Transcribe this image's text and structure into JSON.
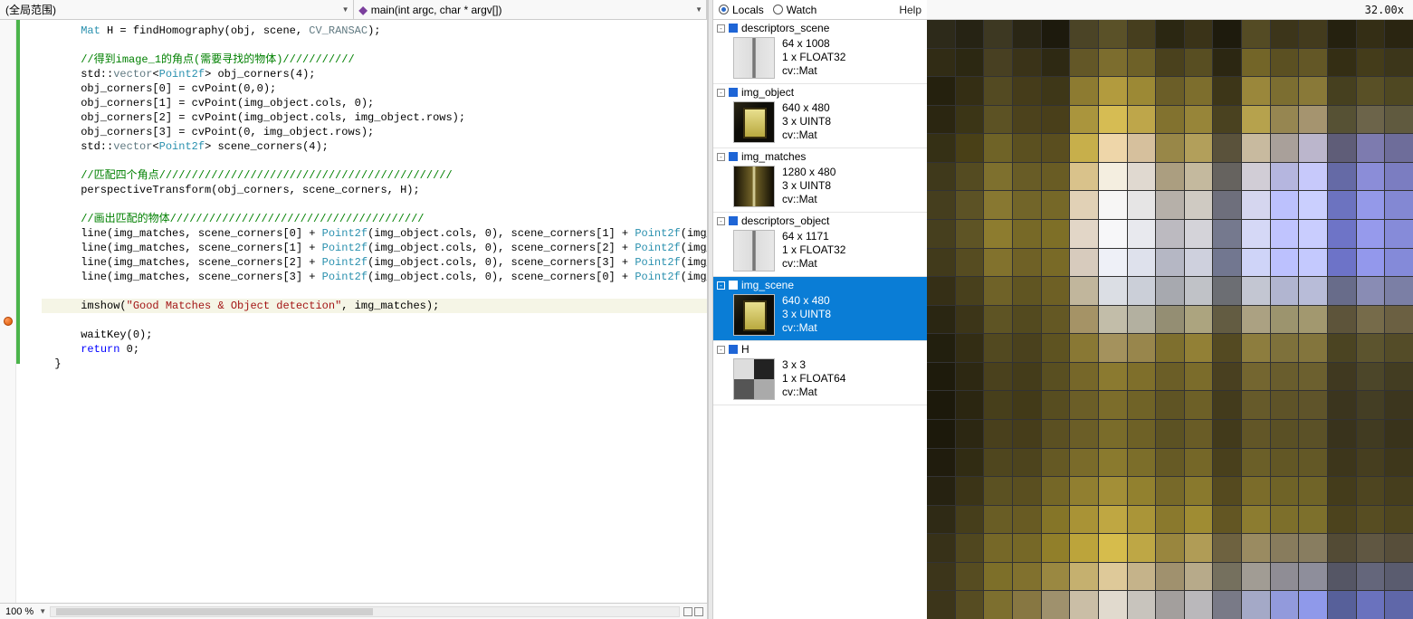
{
  "selectors": {
    "scope": "(全局范围)",
    "function": "main(int argc, char * argv[])"
  },
  "code_tokens": [
    [
      [
        "      "
      ],
      [
        "Mat",
        "type"
      ],
      [
        " H = findHomography(obj, scene, "
      ],
      [
        "CV_RANSAC",
        "teal"
      ],
      [
        ");"
      ]
    ],
    [
      [
        ""
      ]
    ],
    [
      [
        "      "
      ],
      [
        "//得到image_1的角点(需要寻找的物体)///////////",
        "comment"
      ]
    ],
    [
      [
        "      std::"
      ],
      [
        "vector",
        "teal"
      ],
      [
        "<"
      ],
      [
        "Point2f",
        "type"
      ],
      [
        "> obj_corners(4);"
      ]
    ],
    [
      [
        "      obj_corners[0] = cvPoint(0,0);"
      ]
    ],
    [
      [
        "      obj_corners[1] = cvPoint(img_object.cols, 0);"
      ]
    ],
    [
      [
        "      obj_corners[2] = cvPoint(img_object.cols, img_object.rows);"
      ]
    ],
    [
      [
        "      obj_corners[3] = cvPoint(0, img_object.rows);"
      ]
    ],
    [
      [
        "      std::"
      ],
      [
        "vector",
        "teal"
      ],
      [
        "<"
      ],
      [
        "Point2f",
        "type"
      ],
      [
        "> scene_corners(4);"
      ]
    ],
    [
      [
        ""
      ]
    ],
    [
      [
        "      "
      ],
      [
        "//匹配四个角点/////////////////////////////////////////////",
        "comment"
      ]
    ],
    [
      [
        "      perspectiveTransform(obj_corners, scene_corners, H);"
      ]
    ],
    [
      [
        ""
      ]
    ],
    [
      [
        "      "
      ],
      [
        "//画出匹配的物体///////////////////////////////////////",
        "comment"
      ]
    ],
    [
      [
        "      line(img_matches, scene_corners[0] + "
      ],
      [
        "Point2f",
        "type"
      ],
      [
        "(img_object.cols, 0), scene_corners[1] + "
      ],
      [
        "Point2f",
        "type"
      ],
      [
        "(img_ob"
      ]
    ],
    [
      [
        "      line(img_matches, scene_corners[1] + "
      ],
      [
        "Point2f",
        "type"
      ],
      [
        "(img_object.cols, 0), scene_corners[2] + "
      ],
      [
        "Point2f",
        "type"
      ],
      [
        "(img_ob"
      ]
    ],
    [
      [
        "      line(img_matches, scene_corners[2] + "
      ],
      [
        "Point2f",
        "type"
      ],
      [
        "(img_object.cols, 0), scene_corners[3] + "
      ],
      [
        "Point2f",
        "type"
      ],
      [
        "(img_ob"
      ]
    ],
    [
      [
        "      line(img_matches, scene_corners[3] + "
      ],
      [
        "Point2f",
        "type"
      ],
      [
        "(img_object.cols, 0), scene_corners[0] + "
      ],
      [
        "Point2f",
        "type"
      ],
      [
        "(img_ob"
      ]
    ],
    [
      [
        ""
      ]
    ],
    [
      [
        "      imshow("
      ],
      [
        "\"Good Matches & Object detection\"",
        "str"
      ],
      [
        ", img_matches);"
      ]
    ],
    [
      [
        ""
      ]
    ],
    [
      [
        "      waitKey(0);"
      ]
    ],
    [
      [
        "      "
      ],
      [
        "return",
        "blue"
      ],
      [
        " 0;"
      ]
    ],
    [
      [
        "  }"
      ]
    ]
  ],
  "highlight_index": 19,
  "zoom": "100 %",
  "inspector": {
    "tab_locals": "Locals",
    "tab_watch": "Watch",
    "help": "Help",
    "vars": [
      {
        "name": "descriptors_scene",
        "dims": "64 x 1008",
        "type": "1 x FLOAT32",
        "cls": "cv::Mat",
        "thumb": "grad",
        "selected": false
      },
      {
        "name": "img_object",
        "dims": "640 x 480",
        "type": "3 x UINT8",
        "cls": "cv::Mat",
        "thumb": "obj",
        "selected": false
      },
      {
        "name": "img_matches",
        "dims": "1280 x 480",
        "type": "3 x UINT8",
        "cls": "cv::Mat",
        "thumb": "match",
        "selected": false
      },
      {
        "name": "descriptors_object",
        "dims": "64 x 1171",
        "type": "1 x FLOAT32",
        "cls": "cv::Mat",
        "thumb": "grad",
        "selected": false
      },
      {
        "name": "img_scene",
        "dims": "640 x 480",
        "type": "3 x UINT8",
        "cls": "cv::Mat",
        "thumb": "obj",
        "selected": true
      },
      {
        "name": "H",
        "dims": "3 x 3",
        "type": "1 x FLOAT64",
        "cls": "cv::Mat",
        "thumb": "chk",
        "selected": false
      }
    ]
  },
  "image_zoom": "32.00x",
  "pixel_colors": [
    "#2d2a1a",
    "#262314",
    "#3d3822",
    "#2a2615",
    "#1d1a0d",
    "#4b4426",
    "#5a5128",
    "#463e1e",
    "#2b2712",
    "#3a3318",
    "#1e1b0d",
    "#544b24",
    "#3c351a",
    "#433b1d",
    "#25210f",
    "#342e15",
    "#2a2511",
    "#312c15",
    "#2c2812",
    "#484022",
    "#3a3318",
    "#2e2913",
    "#635727",
    "#7c6d2e",
    "#6e6128",
    "#4a411d",
    "#584e22",
    "#2c2712",
    "#736528",
    "#5b5022",
    "#635726",
    "#342e14",
    "#443c1a",
    "#3c361a",
    "#25210e",
    "#342e14",
    "#534a22",
    "#453c1a",
    "#3e3718",
    "#8d7b31",
    "#b29b3e",
    "#9c8935",
    "#6b5e28",
    "#7d6e2d",
    "#3d3618",
    "#9a873b",
    "#7c6e31",
    "#897938",
    "#46401f",
    "#595026",
    "#4f4822",
    "#2b2611",
    "#3b3516",
    "#5c5224",
    "#4c421c",
    "#493f1a",
    "#aa953d",
    "#d6bc53",
    "#bea64a",
    "#82722f",
    "#978539",
    "#4a4220",
    "#b6a24d",
    "#968651",
    "#a5946f",
    "#565134",
    "#6c644a",
    "#605a3f",
    "#353015",
    "#494017",
    "#6f6327",
    "#5b5020",
    "#5a4e1f",
    "#c7af4b",
    "#eed6a9",
    "#d6c09d",
    "#988748",
    "#b29f5b",
    "#5a523b",
    "#c8ba9f",
    "#a9a09a",
    "#bbb6cc",
    "#5f5d78",
    "#7d7baf",
    "#6e6d9a",
    "#3f391b",
    "#544b21",
    "#7e702e",
    "#685c26",
    "#695c24",
    "#d9c28b",
    "#f4eee0",
    "#e0d9d0",
    "#ab9e80",
    "#c4b99e",
    "#66635f",
    "#d1cdd6",
    "#b5b6df",
    "#c7c9fb",
    "#656aa6",
    "#8b8dd8",
    "#7b7dc1",
    "#453e1e",
    "#5c5225",
    "#887831",
    "#726529",
    "#766828",
    "#e1d1b6",
    "#f7f6f5",
    "#e6e5e5",
    "#b6b0a9",
    "#cfcac2",
    "#6e6f7c",
    "#d5d6ef",
    "#bcc1fd",
    "#cacffe",
    "#6c73c0",
    "#9499e9",
    "#8388d3",
    "#463f1e",
    "#5e5425",
    "#8d7c2f",
    "#776927",
    "#7e6f27",
    "#e2d6c7",
    "#f7f7f9",
    "#e8e9ee",
    "#bcbac0",
    "#d4d3d9",
    "#75798e",
    "#d5d8f6",
    "#c0c4fe",
    "#c9cdfe",
    "#6e74c7",
    "#969aec",
    "#868bd9",
    "#413a1b",
    "#564c21",
    "#82722d",
    "#6f6126",
    "#796a27",
    "#d7cbbd",
    "#eef0f7",
    "#dee1ec",
    "#b5b7c4",
    "#ced0dd",
    "#727790",
    "#cfd4f8",
    "#bcc1fe",
    "#c4c9fe",
    "#6d73c8",
    "#9398ec",
    "#848ad9",
    "#352f16",
    "#48401c",
    "#6f6228",
    "#605522",
    "#6e6025",
    "#c1b69c",
    "#dbdee4",
    "#cbcfd8",
    "#a7a9af",
    "#c0c2c7",
    "#6c6e73",
    "#c3c6d2",
    "#b1b5d0",
    "#b8bcd8",
    "#686c8a",
    "#898cb4",
    "#7b7fa5",
    "#2a2612",
    "#3c3518",
    "#5e5424",
    "#534a1f",
    "#645824",
    "#a59366",
    "#c2bda9",
    "#b3b0a0",
    "#948e73",
    "#aca47f",
    "#635c42",
    "#aba182",
    "#9c946e",
    "#a2986f",
    "#5d543a",
    "#766b4a",
    "#6b6042",
    "#221f0e",
    "#332d14",
    "#524920",
    "#4a411d",
    "#5e5321",
    "#897834",
    "#a4925d",
    "#98864c",
    "#7e6f2e",
    "#928036",
    "#544a22",
    "#8d7d3e",
    "#7e713b",
    "#83753d",
    "#4b4422",
    "#5c542e",
    "#544c28",
    "#1e1b0c",
    "#2d2812",
    "#4a411d",
    "#443c1a",
    "#594f21",
    "#766729",
    "#8b7a30",
    "#7f6f2b",
    "#6b5e27",
    "#7b6c2b",
    "#494020",
    "#746630",
    "#695d2d",
    "#6c602f",
    "#403920",
    "#4c4629",
    "#433d22",
    "#1c190b",
    "#2b2611",
    "#473f1b",
    "#423a18",
    "#574d20",
    "#6b5e27",
    "#7c6d2b",
    "#706327",
    "#5f5424",
    "#6d6027",
    "#433b1c",
    "#665a2a",
    "#5e5328",
    "#5f542a",
    "#3b351e",
    "#443e24",
    "#3c361e",
    "#1c190b",
    "#2c2712",
    "#49401c",
    "#463d1a",
    "#5b5022",
    "#6b5e27",
    "#7a6c2a",
    "#6e6126",
    "#5c5223",
    "#695c26",
    "#423a1b",
    "#625627",
    "#5a5025",
    "#5b5127",
    "#39331c",
    "#413b21",
    "#39331b",
    "#201c0d",
    "#312c13",
    "#4f461e",
    "#4d441d",
    "#655924",
    "#7a6b2a",
    "#8a7a2e",
    "#7c6e2a",
    "#665a25",
    "#756728",
    "#49401c",
    "#6b5f28",
    "#625725",
    "#635826",
    "#3d361b",
    "#463e1f",
    "#3e371b",
    "#262211",
    "#3b3417",
    "#5b5122",
    "#5a4f20",
    "#756727",
    "#917f30",
    "#a38f37",
    "#92812f",
    "#776929",
    "#89792d",
    "#554a1f",
    "#7b6c2a",
    "#6f6327",
    "#706428",
    "#443c1b",
    "#4e4520",
    "#463e1d",
    "#2f2a15",
    "#463e1b",
    "#695d25",
    "#685b23",
    "#857528",
    "#a99336",
    "#bfa742",
    "#aa9538",
    "#8a792d",
    "#9f8c33",
    "#635623",
    "#8c7c30",
    "#7d6f2b",
    "#7d702c",
    "#4c431d",
    "#574d22",
    "#4f461f",
    "#373118",
    "#50471f",
    "#766828",
    "#766827",
    "#917f2a",
    "#bca43b",
    "#d6bc4c",
    "#bea745",
    "#99863e",
    "#b09c56",
    "#6e6240",
    "#9a8b61",
    "#887c5d",
    "#887d60",
    "#534b35",
    "#605742",
    "#574e3a",
    "#3c351a",
    "#564c21",
    "#7d6f29",
    "#81712e",
    "#9a8841",
    "#c5b06f",
    "#dec999",
    "#c5b38a",
    "#a0916e",
    "#b7aa8a",
    "#75705e",
    "#a19c94",
    "#8f8d95",
    "#8e8e9b",
    "#555665",
    "#64667b",
    "#5a5c6f",
    "#3c351a",
    "#564c22",
    "#7d6f2f",
    "#877742",
    "#9f916d",
    "#cabea6",
    "#e1dace",
    "#c8c4bd",
    "#a39f9d",
    "#bab8bb",
    "#797a87",
    "#a4a9c7",
    "#929adc",
    "#8f99ea",
    "#57609a",
    "#6a72be",
    "#5f67a9"
  ]
}
